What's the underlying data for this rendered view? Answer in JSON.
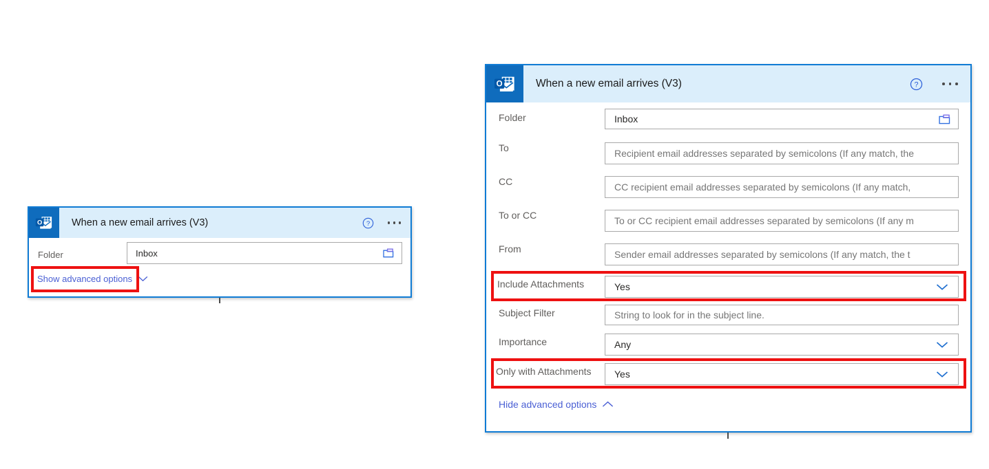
{
  "cards": {
    "collapsed": {
      "icon_name": "outlook-icon",
      "title": "When a new email arrives (V3)",
      "help_icon": "help-circle-icon",
      "more_icon": "more-options-icon",
      "rows": [
        {
          "label": "Folder",
          "value": "Inbox",
          "is_placeholder": false,
          "trailing_icon": "folder-picker-icon"
        }
      ],
      "advanced_link": {
        "label": "Show advanced options",
        "chevron": "chevron-down-icon"
      }
    },
    "expanded": {
      "icon_name": "outlook-icon",
      "title": "When a new email arrives (V3)",
      "help_icon": "help-circle-icon",
      "more_icon": "more-options-icon",
      "rows": [
        {
          "label": "Folder",
          "value": "Inbox",
          "is_placeholder": false,
          "trailing_icon": "folder-picker-icon",
          "highlighted": false
        },
        {
          "label": "To",
          "value": "Recipient email addresses separated by semicolons (If any match, the",
          "is_placeholder": true,
          "trailing_icon": "",
          "highlighted": false
        },
        {
          "label": "CC",
          "value": "CC recipient email addresses separated by semicolons (If any match,",
          "is_placeholder": true,
          "trailing_icon": "",
          "highlighted": false
        },
        {
          "label": "To or CC",
          "value": "To or CC recipient email addresses separated by semicolons (If any m",
          "is_placeholder": true,
          "trailing_icon": "",
          "highlighted": false
        },
        {
          "label": "From",
          "value": "Sender email addresses separated by semicolons (If any match, the t",
          "is_placeholder": true,
          "trailing_icon": "",
          "highlighted": false
        },
        {
          "label": "Include Attachments",
          "value": "Yes",
          "is_placeholder": false,
          "trailing_icon": "chevron-down-icon",
          "highlighted": true
        },
        {
          "label": "Subject Filter",
          "value": "String to look for in the subject line.",
          "is_placeholder": true,
          "trailing_icon": "",
          "highlighted": false
        },
        {
          "label": "Importance",
          "value": "Any",
          "is_placeholder": false,
          "trailing_icon": "chevron-down-icon",
          "highlighted": false
        },
        {
          "label": "Only with Attachments",
          "value": "Yes",
          "is_placeholder": false,
          "trailing_icon": "chevron-down-icon",
          "highlighted": true
        }
      ],
      "advanced_link": {
        "label": "Hide advanced options",
        "chevron": "chevron-up-icon"
      }
    }
  },
  "colors": {
    "card_border": "#0f7bd4",
    "header_bg": "#dbeefb",
    "app_tile": "#0f6cbd",
    "highlight": "#ee1111",
    "link": "#4a5fd4",
    "chevron": "#1f6fd0"
  }
}
